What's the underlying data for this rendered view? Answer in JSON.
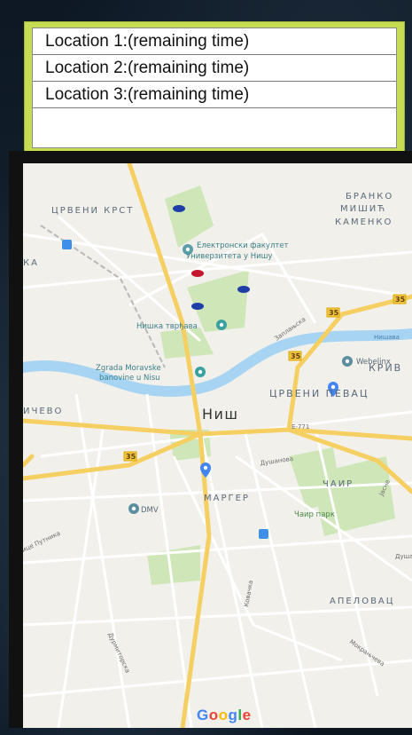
{
  "locations": {
    "items": [
      {
        "label": "Location 1:(remaining time)"
      },
      {
        "label": "Location 2:(remaining time)"
      },
      {
        "label": "Location 3:(remaining time)"
      }
    ]
  },
  "map": {
    "labels": {
      "crveni_krst": "ЦРВЕНИ КРСТ",
      "branko_1": "БРАНКО",
      "branko_2": "МИШИЋ",
      "branko_3": "КАМЕНКО",
      "elfak_1": "Електронски факултет",
      "elfak_2": "Универзитета у Нишу",
      "trzhava": "Нишка тврђава",
      "zgrada_1": "Zgrada Moravske",
      "zgrada_2": "banovine u Nisu",
      "niš": "Ниш",
      "crveni_pevac": "ЦРВЕНИ ПЕВАЦ",
      "kriv": "КРИВ",
      "webelinx": "Webelinx",
      "chevo": "ИЧЕВО",
      "e771": "E-771",
      "dushanova": "Душанова",
      "chair": "ЧАИР",
      "chair_park": "Чаир парк",
      "marger": "МАРГЕР",
      "dmv": "DMV",
      "puteva": "ице Путника",
      "apelovac": "АПЕЛОВАЦ",
      "k_left": "КА",
      "zaplanska": "Заплањска",
      "nishava": "Нишава",
      "kovachka": "Ковачка",
      "kralja": "Дурмиторска",
      "mokranjceva": "Мокрањчева",
      "jaseta": "Јасне",
      "dusan2": "Душа",
      "shield_35a": "35",
      "shield_35b": "35",
      "shield_35c": "35",
      "shield_35d": "35",
      "google": "Google"
    },
    "colors": {
      "marker_blue": "#1f3fa8",
      "marker_red": "#c2172d",
      "pin_blue": "#4285f4",
      "pin_teal": "#3aa0a0",
      "road_major": "#f6cf63",
      "river": "#9fd0f0",
      "park": "#c8e6b0"
    }
  }
}
